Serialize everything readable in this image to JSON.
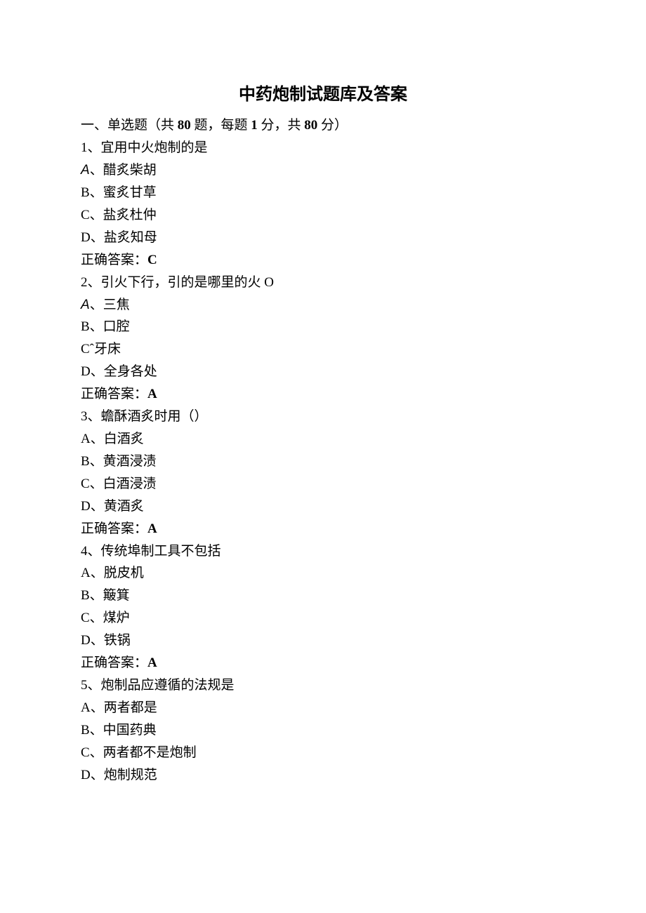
{
  "title": "中药炮制试题库及答案",
  "section": {
    "prefix": "一、单选题（共 ",
    "count1": "80",
    "mid1": " 题，每题 ",
    "points": "1",
    "mid2": " 分，共 ",
    "count2": "80",
    "suffix": " 分）"
  },
  "q1": {
    "stem": "1、宜用中火炮制的是",
    "a_prefix": "A",
    "a_text": "、醋炙柴胡",
    "b": "B、蜜炙甘草",
    "c": "C、盐炙杜仲",
    "d": "D、盐炙知母",
    "ans_label": "正确答案：",
    "ans": "C"
  },
  "q2": {
    "stem": "2、引火下行，引的是哪里的火 O",
    "a_prefix": "A",
    "a_text": "、三焦",
    "b": "B、口腔",
    "c": "Cˆ牙床",
    "d": "D、全身各处",
    "ans_label": "正确答案：",
    "ans": "A"
  },
  "q3": {
    "stem": "3、蟾酥酒炙时用（）",
    "a": "A、白酒炙",
    "b": "B、黄酒浸渍",
    "c": "C、白酒浸渍",
    "d": "D、黄酒炙",
    "ans_label": "正确答案：",
    "ans": "A"
  },
  "q4": {
    "stem": "4、传统埠制工具不包括",
    "a": "A、脱皮机",
    "b": "B、簸箕",
    "c": "C、煤炉",
    "d": "D、铁锅",
    "ans_label": "正确答案：",
    "ans": "A"
  },
  "q5": {
    "stem": "5、炮制品应遵循的法规是",
    "a": "A、两者都是",
    "b": "B、中国药典",
    "c": "C、两者都不是炮制",
    "d": "D、炮制规范"
  }
}
